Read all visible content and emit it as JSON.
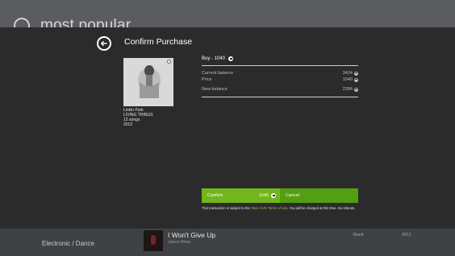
{
  "background": {
    "title": "most popular",
    "genre": "Electronic / Dance",
    "song": {
      "title": "I Won't Give Up",
      "artist": "Jason Mraz",
      "genre": "Rock",
      "year": "2011"
    }
  },
  "dialog": {
    "title": "Confirm Purchase",
    "album": {
      "artist": "Linkin Park",
      "name": "LIVING THINGS",
      "songs": "12 songs",
      "year": "2012"
    },
    "buy_label": "Buy - 1040",
    "current_balance_label": "Current balance",
    "current_balance_value": "3424",
    "price_label": "Price",
    "price_value": "1040",
    "new_balance_label": "New balance",
    "new_balance_value": "2384",
    "confirm_label": "Confirm",
    "confirm_amount": "1040",
    "cancel_label": "Cancel",
    "terms_prefix": "This transaction is subject to the ",
    "terms_link": "Xbox LIVE Terms of Use",
    "terms_suffix": ". You will be charged at this time. No refunds."
  },
  "colors": {
    "accent": "#73b51d",
    "cancel": "#539e11",
    "modal_bg": "#2b2b2b"
  },
  "icons": {
    "back": "back-arrow-icon",
    "points": "microsoft-points-icon"
  }
}
